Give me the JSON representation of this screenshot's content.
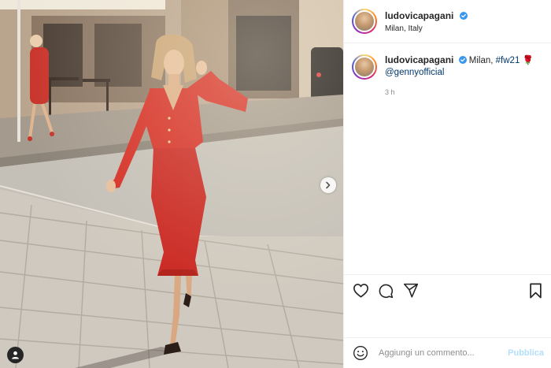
{
  "post": {
    "author": {
      "username": "ludovicapagani",
      "verified": true,
      "location": "Milan, Italy"
    },
    "caption": {
      "username": "ludovicapagani",
      "text": "Milan,",
      "hashtag": "#fw21",
      "emoji": "🌹",
      "mention": "@gennyofficial"
    },
    "time_ago": "3 h"
  },
  "actions": {
    "like": "heart-icon",
    "comment": "comment-icon",
    "share": "paper-plane-icon",
    "save": "bookmark-icon"
  },
  "comment_box": {
    "placeholder": "Aggiungi un commento...",
    "publish_label": "Pubblica",
    "emoji": "smiley-icon"
  },
  "colors": {
    "verified_blue": "#3897f0",
    "link": "#00376b",
    "publish_disabled": "#b2dffc",
    "dress_red": "#d42b22"
  }
}
